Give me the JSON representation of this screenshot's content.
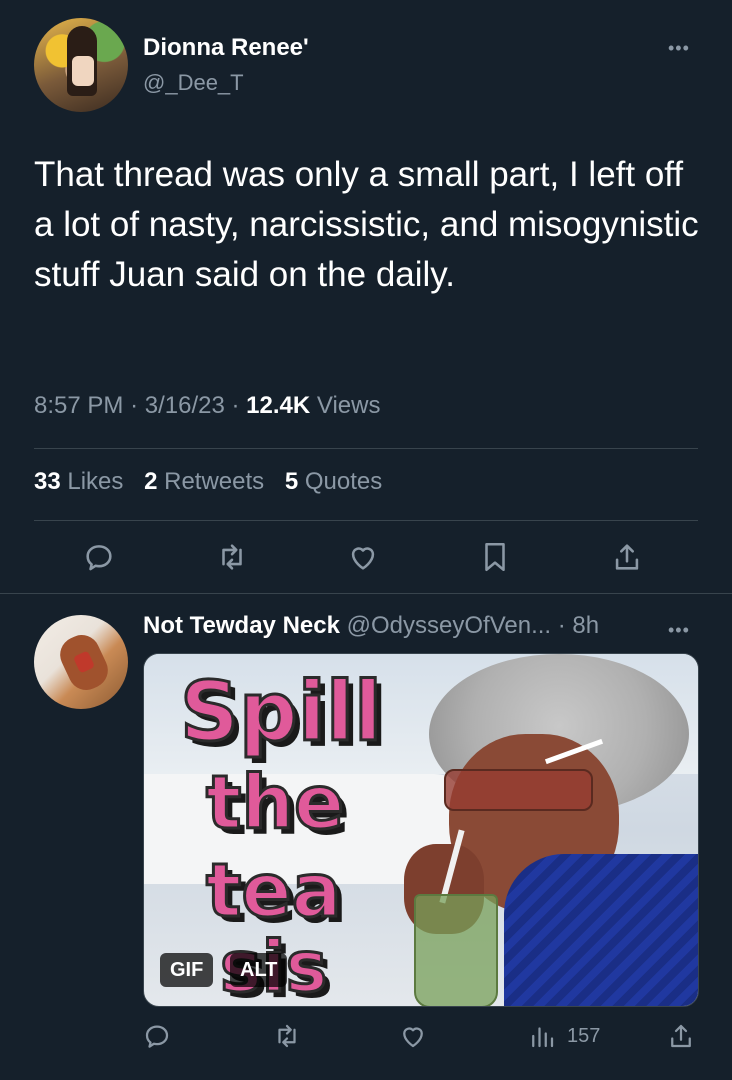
{
  "tweet": {
    "author_name": "Dionna Renee'",
    "author_handle": "@_Dee_T",
    "text": "That thread was only a small part, I left off a lot of nasty, narcissistic, and misogynistic stuff Juan said on the daily.",
    "time": "8:57 PM",
    "date": "3/16/23",
    "views_count": "12.4K",
    "views_label": "Views",
    "likes_count": "33",
    "likes_label": "Likes",
    "retweets_count": "2",
    "retweets_label": "Retweets",
    "quotes_count": "5",
    "quotes_label": "Quotes",
    "more_icon": "more-icon",
    "actions": [
      "reply-icon",
      "retweet-icon",
      "like-icon",
      "bookmark-icon",
      "share-icon"
    ]
  },
  "reply": {
    "author_name": "Not Tewday Neck",
    "author_handle": "@OdysseyOfVen...",
    "time_ago": "8h",
    "gif_text_lines": [
      "Spill",
      "the",
      "tea",
      "sis"
    ],
    "gif_badge": "GIF",
    "alt_badge": "ALT",
    "views_count": "157",
    "actions": [
      "reply-icon",
      "retweet-icon",
      "like-icon",
      "views-icon",
      "share-icon"
    ]
  },
  "colors": {
    "background": "#15202b",
    "text": "#ffffff",
    "secondary": "#8b98a5",
    "divider": "#38444d",
    "gif_text": "#e05a9a"
  }
}
